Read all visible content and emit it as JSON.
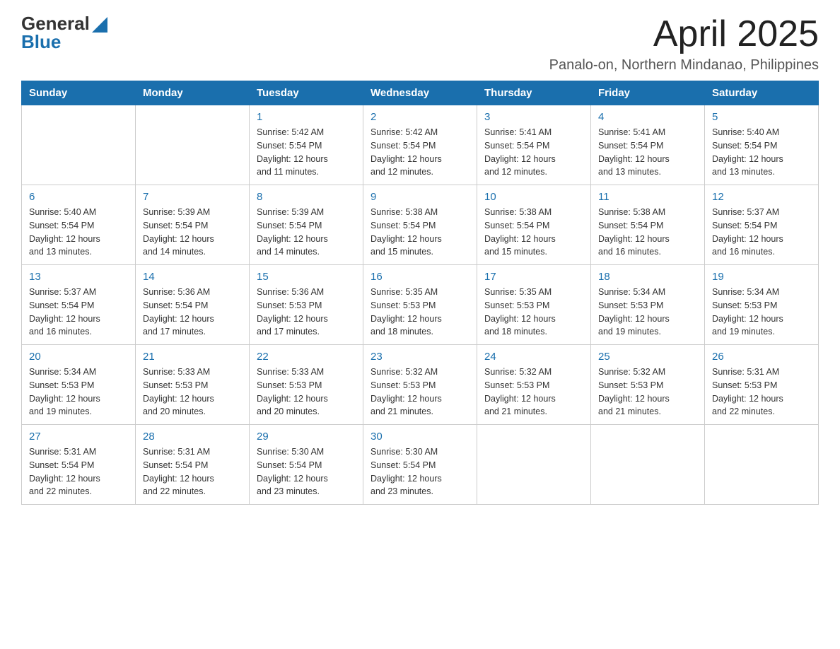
{
  "header": {
    "logo_general": "General",
    "logo_blue": "Blue",
    "month_title": "April 2025",
    "location": "Panalo-on, Northern Mindanao, Philippines"
  },
  "calendar": {
    "days_of_week": [
      "Sunday",
      "Monday",
      "Tuesday",
      "Wednesday",
      "Thursday",
      "Friday",
      "Saturday"
    ],
    "weeks": [
      [
        {
          "day": "",
          "info": ""
        },
        {
          "day": "",
          "info": ""
        },
        {
          "day": "1",
          "info": "Sunrise: 5:42 AM\nSunset: 5:54 PM\nDaylight: 12 hours\nand 11 minutes."
        },
        {
          "day": "2",
          "info": "Sunrise: 5:42 AM\nSunset: 5:54 PM\nDaylight: 12 hours\nand 12 minutes."
        },
        {
          "day": "3",
          "info": "Sunrise: 5:41 AM\nSunset: 5:54 PM\nDaylight: 12 hours\nand 12 minutes."
        },
        {
          "day": "4",
          "info": "Sunrise: 5:41 AM\nSunset: 5:54 PM\nDaylight: 12 hours\nand 13 minutes."
        },
        {
          "day": "5",
          "info": "Sunrise: 5:40 AM\nSunset: 5:54 PM\nDaylight: 12 hours\nand 13 minutes."
        }
      ],
      [
        {
          "day": "6",
          "info": "Sunrise: 5:40 AM\nSunset: 5:54 PM\nDaylight: 12 hours\nand 13 minutes."
        },
        {
          "day": "7",
          "info": "Sunrise: 5:39 AM\nSunset: 5:54 PM\nDaylight: 12 hours\nand 14 minutes."
        },
        {
          "day": "8",
          "info": "Sunrise: 5:39 AM\nSunset: 5:54 PM\nDaylight: 12 hours\nand 14 minutes."
        },
        {
          "day": "9",
          "info": "Sunrise: 5:38 AM\nSunset: 5:54 PM\nDaylight: 12 hours\nand 15 minutes."
        },
        {
          "day": "10",
          "info": "Sunrise: 5:38 AM\nSunset: 5:54 PM\nDaylight: 12 hours\nand 15 minutes."
        },
        {
          "day": "11",
          "info": "Sunrise: 5:38 AM\nSunset: 5:54 PM\nDaylight: 12 hours\nand 16 minutes."
        },
        {
          "day": "12",
          "info": "Sunrise: 5:37 AM\nSunset: 5:54 PM\nDaylight: 12 hours\nand 16 minutes."
        }
      ],
      [
        {
          "day": "13",
          "info": "Sunrise: 5:37 AM\nSunset: 5:54 PM\nDaylight: 12 hours\nand 16 minutes."
        },
        {
          "day": "14",
          "info": "Sunrise: 5:36 AM\nSunset: 5:54 PM\nDaylight: 12 hours\nand 17 minutes."
        },
        {
          "day": "15",
          "info": "Sunrise: 5:36 AM\nSunset: 5:53 PM\nDaylight: 12 hours\nand 17 minutes."
        },
        {
          "day": "16",
          "info": "Sunrise: 5:35 AM\nSunset: 5:53 PM\nDaylight: 12 hours\nand 18 minutes."
        },
        {
          "day": "17",
          "info": "Sunrise: 5:35 AM\nSunset: 5:53 PM\nDaylight: 12 hours\nand 18 minutes."
        },
        {
          "day": "18",
          "info": "Sunrise: 5:34 AM\nSunset: 5:53 PM\nDaylight: 12 hours\nand 19 minutes."
        },
        {
          "day": "19",
          "info": "Sunrise: 5:34 AM\nSunset: 5:53 PM\nDaylight: 12 hours\nand 19 minutes."
        }
      ],
      [
        {
          "day": "20",
          "info": "Sunrise: 5:34 AM\nSunset: 5:53 PM\nDaylight: 12 hours\nand 19 minutes."
        },
        {
          "day": "21",
          "info": "Sunrise: 5:33 AM\nSunset: 5:53 PM\nDaylight: 12 hours\nand 20 minutes."
        },
        {
          "day": "22",
          "info": "Sunrise: 5:33 AM\nSunset: 5:53 PM\nDaylight: 12 hours\nand 20 minutes."
        },
        {
          "day": "23",
          "info": "Sunrise: 5:32 AM\nSunset: 5:53 PM\nDaylight: 12 hours\nand 21 minutes."
        },
        {
          "day": "24",
          "info": "Sunrise: 5:32 AM\nSunset: 5:53 PM\nDaylight: 12 hours\nand 21 minutes."
        },
        {
          "day": "25",
          "info": "Sunrise: 5:32 AM\nSunset: 5:53 PM\nDaylight: 12 hours\nand 21 minutes."
        },
        {
          "day": "26",
          "info": "Sunrise: 5:31 AM\nSunset: 5:53 PM\nDaylight: 12 hours\nand 22 minutes."
        }
      ],
      [
        {
          "day": "27",
          "info": "Sunrise: 5:31 AM\nSunset: 5:54 PM\nDaylight: 12 hours\nand 22 minutes."
        },
        {
          "day": "28",
          "info": "Sunrise: 5:31 AM\nSunset: 5:54 PM\nDaylight: 12 hours\nand 22 minutes."
        },
        {
          "day": "29",
          "info": "Sunrise: 5:30 AM\nSunset: 5:54 PM\nDaylight: 12 hours\nand 23 minutes."
        },
        {
          "day": "30",
          "info": "Sunrise: 5:30 AM\nSunset: 5:54 PM\nDaylight: 12 hours\nand 23 minutes."
        },
        {
          "day": "",
          "info": ""
        },
        {
          "day": "",
          "info": ""
        },
        {
          "day": "",
          "info": ""
        }
      ]
    ]
  }
}
